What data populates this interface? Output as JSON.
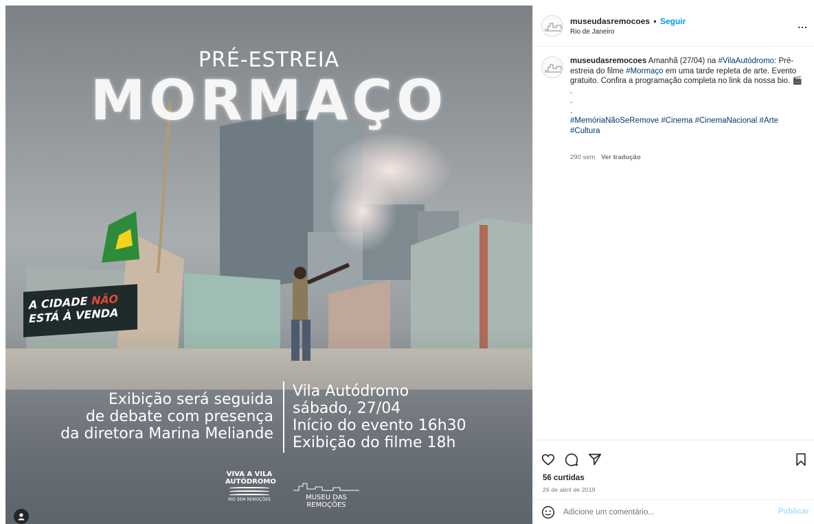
{
  "post": {
    "image": {
      "pre_title": "PRÉ-ESTREIA",
      "title": "MORMAÇO",
      "banner_line1_a": "A CIDADE ",
      "banner_line1_b": "NÃO",
      "banner_line2": "ESTÁ À VENDA",
      "left_lines": [
        "Exibição será seguida",
        "de debate com presença",
        "da diretora Marina Meliande"
      ],
      "right_lines": [
        "Vila Autódromo",
        "sábado, 27/04",
        "Início do evento 16h30",
        "Exibição do filme 18h"
      ],
      "logo_viva_line1": "VIVA A VILA",
      "logo_viva_line2": "AUTÓDROMO",
      "logo_viva_sub": "RIO SEM REMOÇÕES",
      "logo_museu": "MUSEU DAS REMOÇÕES",
      "user_tag_icon": "person-icon"
    }
  },
  "header": {
    "username": "museudasremocoes",
    "separator": "•",
    "follow_label": "Seguir",
    "location": "Rio de Janeiro",
    "more_label": "..."
  },
  "caption": {
    "username": "museudasremocoes",
    "t1": " Amanhã (27/04) na ",
    "tag1": "#VilaAutódromo",
    "t2": ": Pré-estreia do filme ",
    "tag2": "#Mormaço",
    "t3": " em uma tarde repleta de arte. Evento gratuito. Confira a programação completa no link da nossa bio. 🎬",
    "dot1": ".",
    "dot2": ".",
    "dot3": ".",
    "tag3": "#MemóriaNãoSeRemove",
    "tag4": "#Cinema",
    "tag5": "#CinemaNacional",
    "tag6": "#Arte",
    "tag7": "#Cultura",
    "age": "290 sem",
    "translate_label": "Ver tradução"
  },
  "actions": {
    "likes": "56 curtidas",
    "date": "26 de abril de 2019"
  },
  "comment": {
    "placeholder": "Adicione um comentário...",
    "publish_label": "Publicar"
  },
  "colors": {
    "link_blue": "#0095f6",
    "tag_blue": "#00376b",
    "muted": "#737373",
    "publish_disabled": "#b2dffc"
  }
}
